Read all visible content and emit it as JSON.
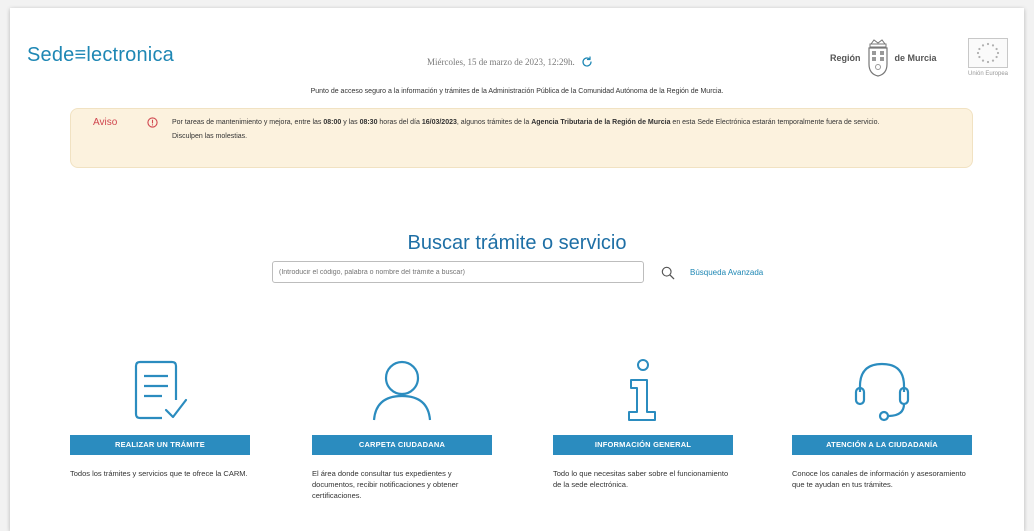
{
  "header": {
    "logo_text": "Sede≡lectronica",
    "datetime": "Miércoles, 15 de marzo de 2023, 12:29h.",
    "tagline": "Punto de acceso seguro a la información y trámites de la Administración Pública de la Comunidad Autónoma de la Región de Murcia.",
    "region_left": "Región",
    "region_right": "de Murcia",
    "eu_label": "Unión Europea"
  },
  "notice": {
    "title": "Aviso",
    "p1_a": "Por tareas de mantenimiento y mejora, entre las ",
    "t1": "08:00",
    "p1_b": " y las ",
    "t2": "08:30",
    "p1_c": " horas del día ",
    "date": "16/03/2023",
    "p1_d": ", algunos trámites de la ",
    "agency": "Agencia Tributaria de la Región de Murcia",
    "p1_e": " en esta Sede Electrónica estarán temporalmente fuera de servicio.",
    "p2": "Disculpen las molestias."
  },
  "search": {
    "title": "Buscar trámite o servicio",
    "placeholder": "(Introducir el código, palabra o nombre del trámite a buscar)",
    "advanced_link": "Búsqueda Avanzada"
  },
  "cards": [
    {
      "label": "REALIZAR UN TRÁMITE",
      "description": "Todos los trámites y servicios que te ofrece la CARM.",
      "icon": "document-check-icon"
    },
    {
      "label": "CARPETA CIUDADANA",
      "description": "El área donde consultar tus expedientes y documentos, recibir notificaciones y obtener certificaciones.",
      "icon": "user-icon"
    },
    {
      "label": "INFORMACIÓN GENERAL",
      "description": "Todo lo que necesitas saber sobre el funcionamiento de la sede electrónica.",
      "icon": "info-icon"
    },
    {
      "label": "ATENCIÓN A LA CIUDADANÍA",
      "description": "Conoce los canales de información y asesoramiento que te ayudan en tus trámites.",
      "icon": "headset-icon"
    }
  ],
  "colors": {
    "brand": "#1e87b4",
    "button": "#2b8cbf",
    "notice_bg": "#fcf2de",
    "notice_title": "#d0464e"
  }
}
